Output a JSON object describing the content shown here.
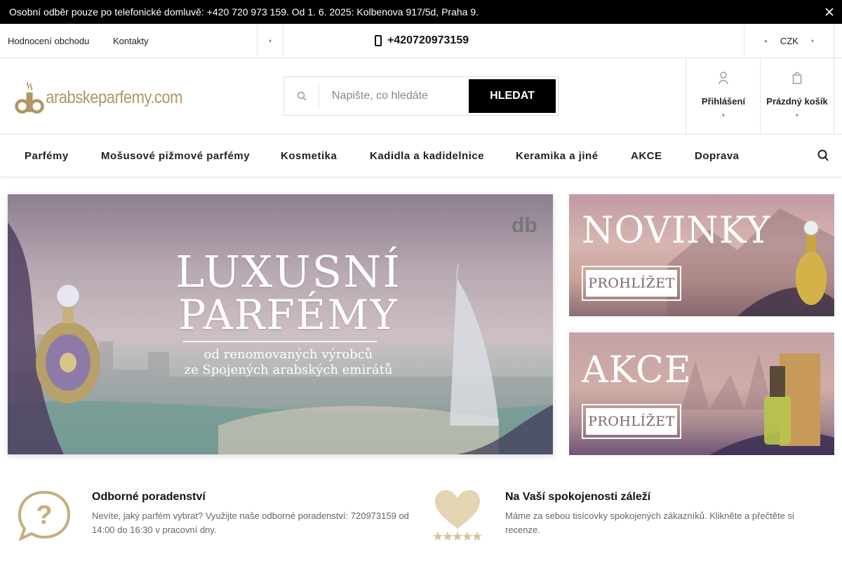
{
  "topbar": {
    "notice": "Osobní odběr pouze po telefonické domluvě: +420 720 973 159. Od 1. 6. 2025: Kolbenova 917/5d, Praha 9."
  },
  "row2": {
    "links": [
      "Hodnocení obchodu",
      "Kontakty"
    ],
    "phone": "+420720973159",
    "currency": "CZK"
  },
  "header": {
    "logo_text": "arabskeparfemy.com",
    "search": {
      "placeholder": "Napište, co hledáte",
      "button": "HLEDAT"
    },
    "login_label": "Přihlášení",
    "cart_label": "Prázdný košík"
  },
  "nav": {
    "items": [
      "Parfémy",
      "Mošusové pižmové parfémy",
      "Kosmetika",
      "Kadidla a kadidelnice",
      "Keramika a jiné",
      "AKCE",
      "Doprava"
    ]
  },
  "banners": {
    "hero": {
      "line1": "LUXUSNÍ",
      "line2": "PARFÉMY",
      "sub1": "od renomovaných výrobců",
      "sub2": "ze Spojených arabských emirátů"
    },
    "novinky": {
      "title": "NOVINKY",
      "cta": "PROHLÍŽET"
    },
    "akce": {
      "title": "AKCE",
      "cta": "PROHLÍŽET"
    }
  },
  "benefits": [
    {
      "title": "Odborné poradenství",
      "desc": "Nevíte, jaký parfém vybrat? Využijte naše odborné poradenství: 720973159 od 14:00 do 16:30 v pracovní dny."
    },
    {
      "title": "Na Vaší spokojenosti záleží",
      "desc": "Máme za sebou tisícovky spokojených zákazníků. Klikněte a přečtěte si recenze."
    }
  ],
  "colors": {
    "brand_gold": "#b09663",
    "dark": "#000000"
  }
}
